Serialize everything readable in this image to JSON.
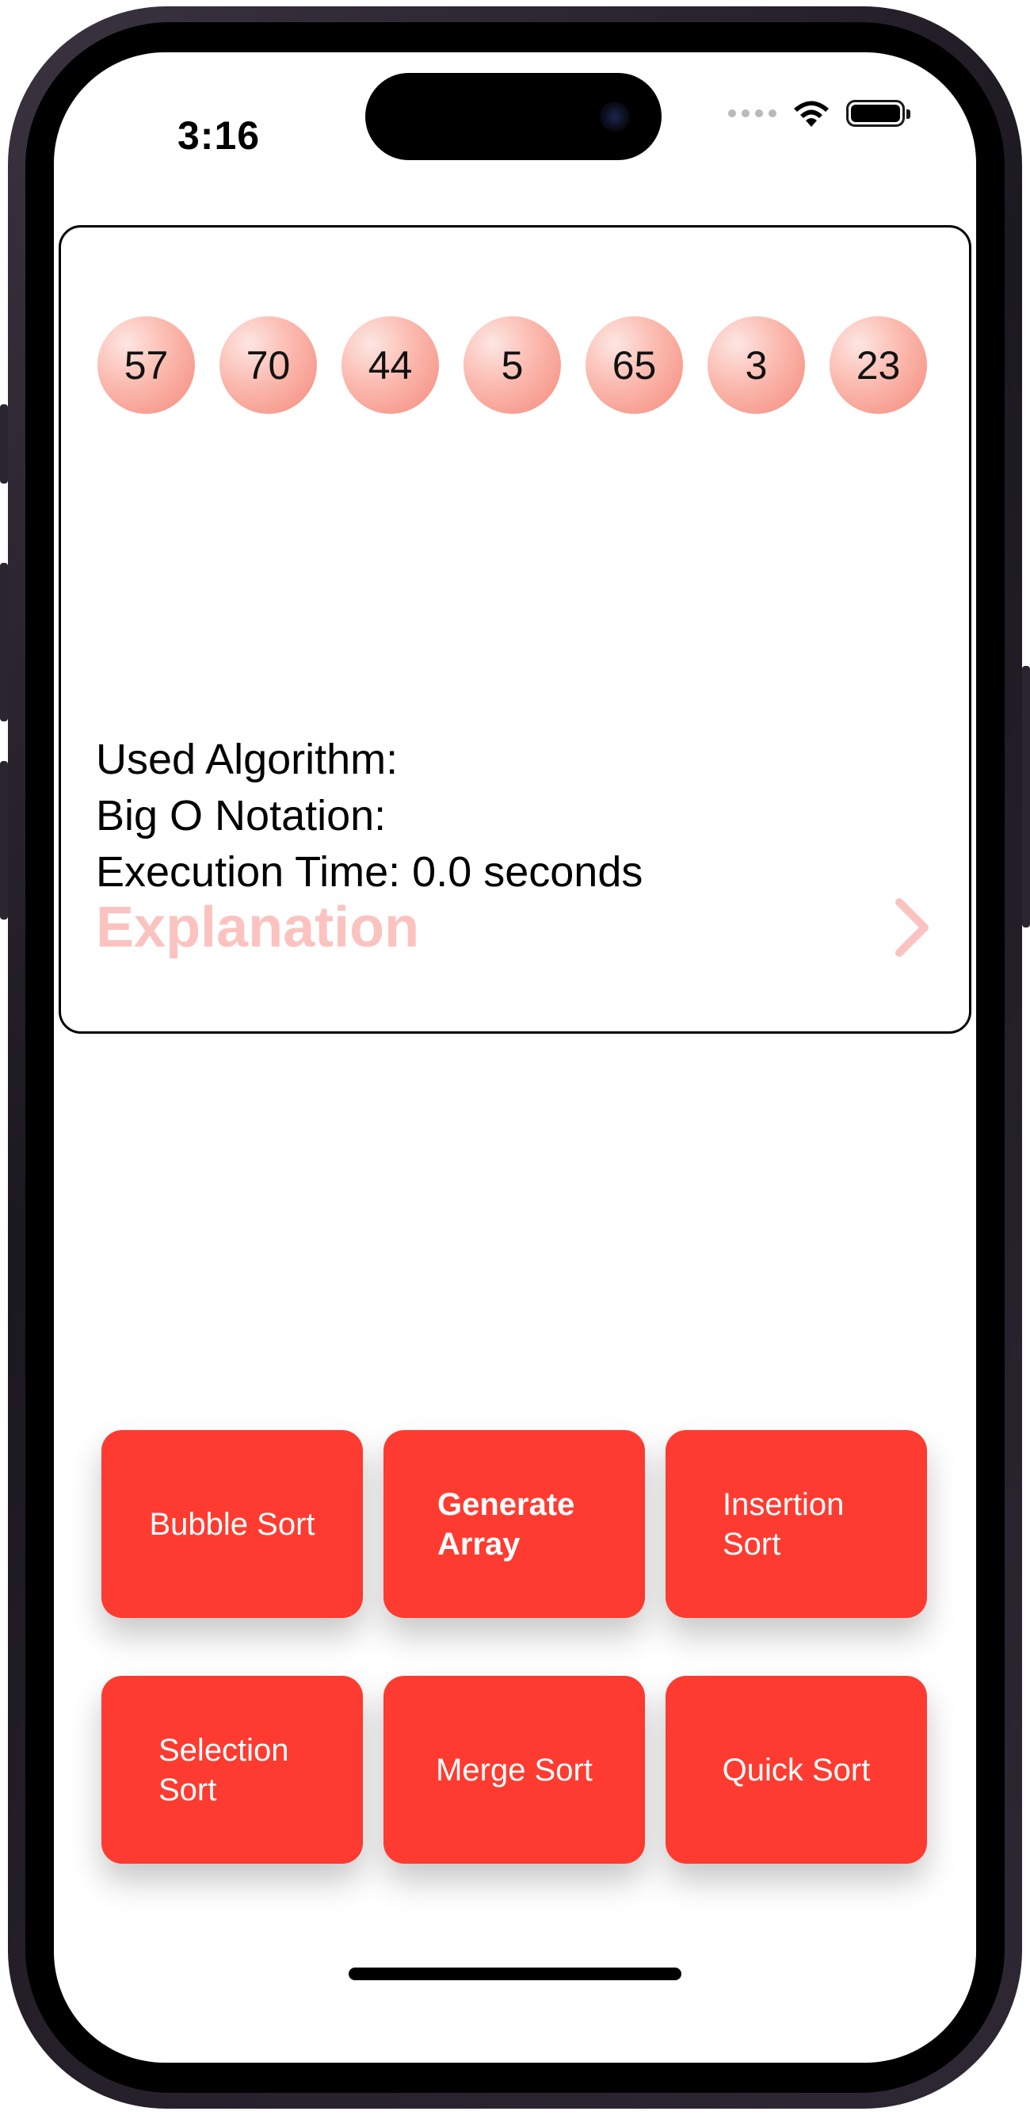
{
  "status_bar": {
    "time": "3:16",
    "icons": [
      "cellular-dots-icon",
      "wifi-icon",
      "battery-icon"
    ]
  },
  "array": {
    "values": [
      "57",
      "70",
      "44",
      "5",
      "65",
      "3",
      "23"
    ]
  },
  "info": {
    "used_algorithm": "Used Algorithm:",
    "big_o": "Big O Notation:",
    "execution_time": "Execution Time: 0.0 seconds"
  },
  "explanation": {
    "label": "Explanation",
    "icon": "chevron-right-icon"
  },
  "buttons": {
    "bubble_sort": "Bubble Sort",
    "generate_array": "Generate Array",
    "insertion_sort": "Insertion Sort",
    "selection_sort": "Selection Sort",
    "merge_sort": "Merge Sort",
    "quick_sort": "Quick Sort"
  },
  "colors": {
    "accent": "#fe3b30",
    "explanation_text": "#fbc3c0",
    "ball_gradient_start": "#fde6e2",
    "ball_gradient_end": "#f58a7c"
  }
}
